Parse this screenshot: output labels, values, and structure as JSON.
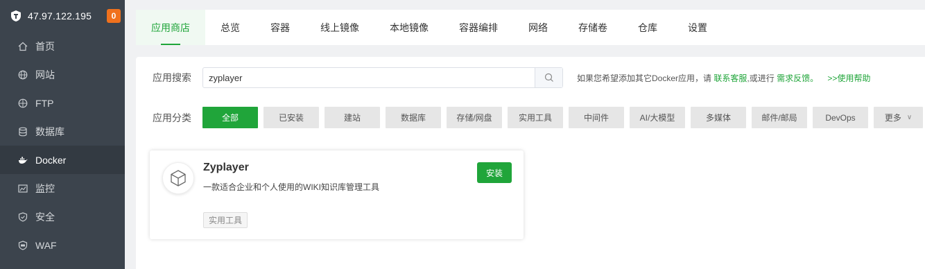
{
  "sidebar": {
    "server_ip": "47.97.122.195",
    "notification_count": "0",
    "items": [
      {
        "label": "首页",
        "icon": "home-icon"
      },
      {
        "label": "网站",
        "icon": "globe-icon"
      },
      {
        "label": "FTP",
        "icon": "ftp-icon"
      },
      {
        "label": "数据库",
        "icon": "database-icon"
      },
      {
        "label": "Docker",
        "icon": "docker-icon",
        "active": true
      },
      {
        "label": "监控",
        "icon": "monitor-icon"
      },
      {
        "label": "安全",
        "icon": "shield-icon"
      },
      {
        "label": "WAF",
        "icon": "waf-icon"
      }
    ]
  },
  "tabs": [
    {
      "label": "应用商店",
      "active": true
    },
    {
      "label": "总览"
    },
    {
      "label": "容器"
    },
    {
      "label": "线上镜像"
    },
    {
      "label": "本地镜像"
    },
    {
      "label": "容器编排"
    },
    {
      "label": "网络"
    },
    {
      "label": "存储卷"
    },
    {
      "label": "仓库"
    },
    {
      "label": "设置"
    }
  ],
  "search": {
    "label": "应用搜索",
    "value": "zyplayer",
    "hint_prefix": "如果您希望添加其它Docker应用，请",
    "contact_link": "联系客服",
    "hint_middle": ",或进行",
    "feedback_link": "需求反馈。",
    "help_link": ">>使用帮助"
  },
  "categories": {
    "label": "应用分类",
    "items": [
      "全部",
      "已安装",
      "建站",
      "数据库",
      "存储/网盘",
      "实用工具",
      "中间件",
      "AI/大模型",
      "多媒体",
      "邮件/邮局",
      "DevOps"
    ],
    "more_label": "更多"
  },
  "app_card": {
    "name": "Zyplayer",
    "description": "一款适合企业和个人使用的WIKI知识库管理工具",
    "tag": "实用工具",
    "install_label": "安装"
  },
  "colors": {
    "accent": "#20a53a",
    "sidebar_bg": "#3c444d",
    "badge": "#f0711d"
  }
}
